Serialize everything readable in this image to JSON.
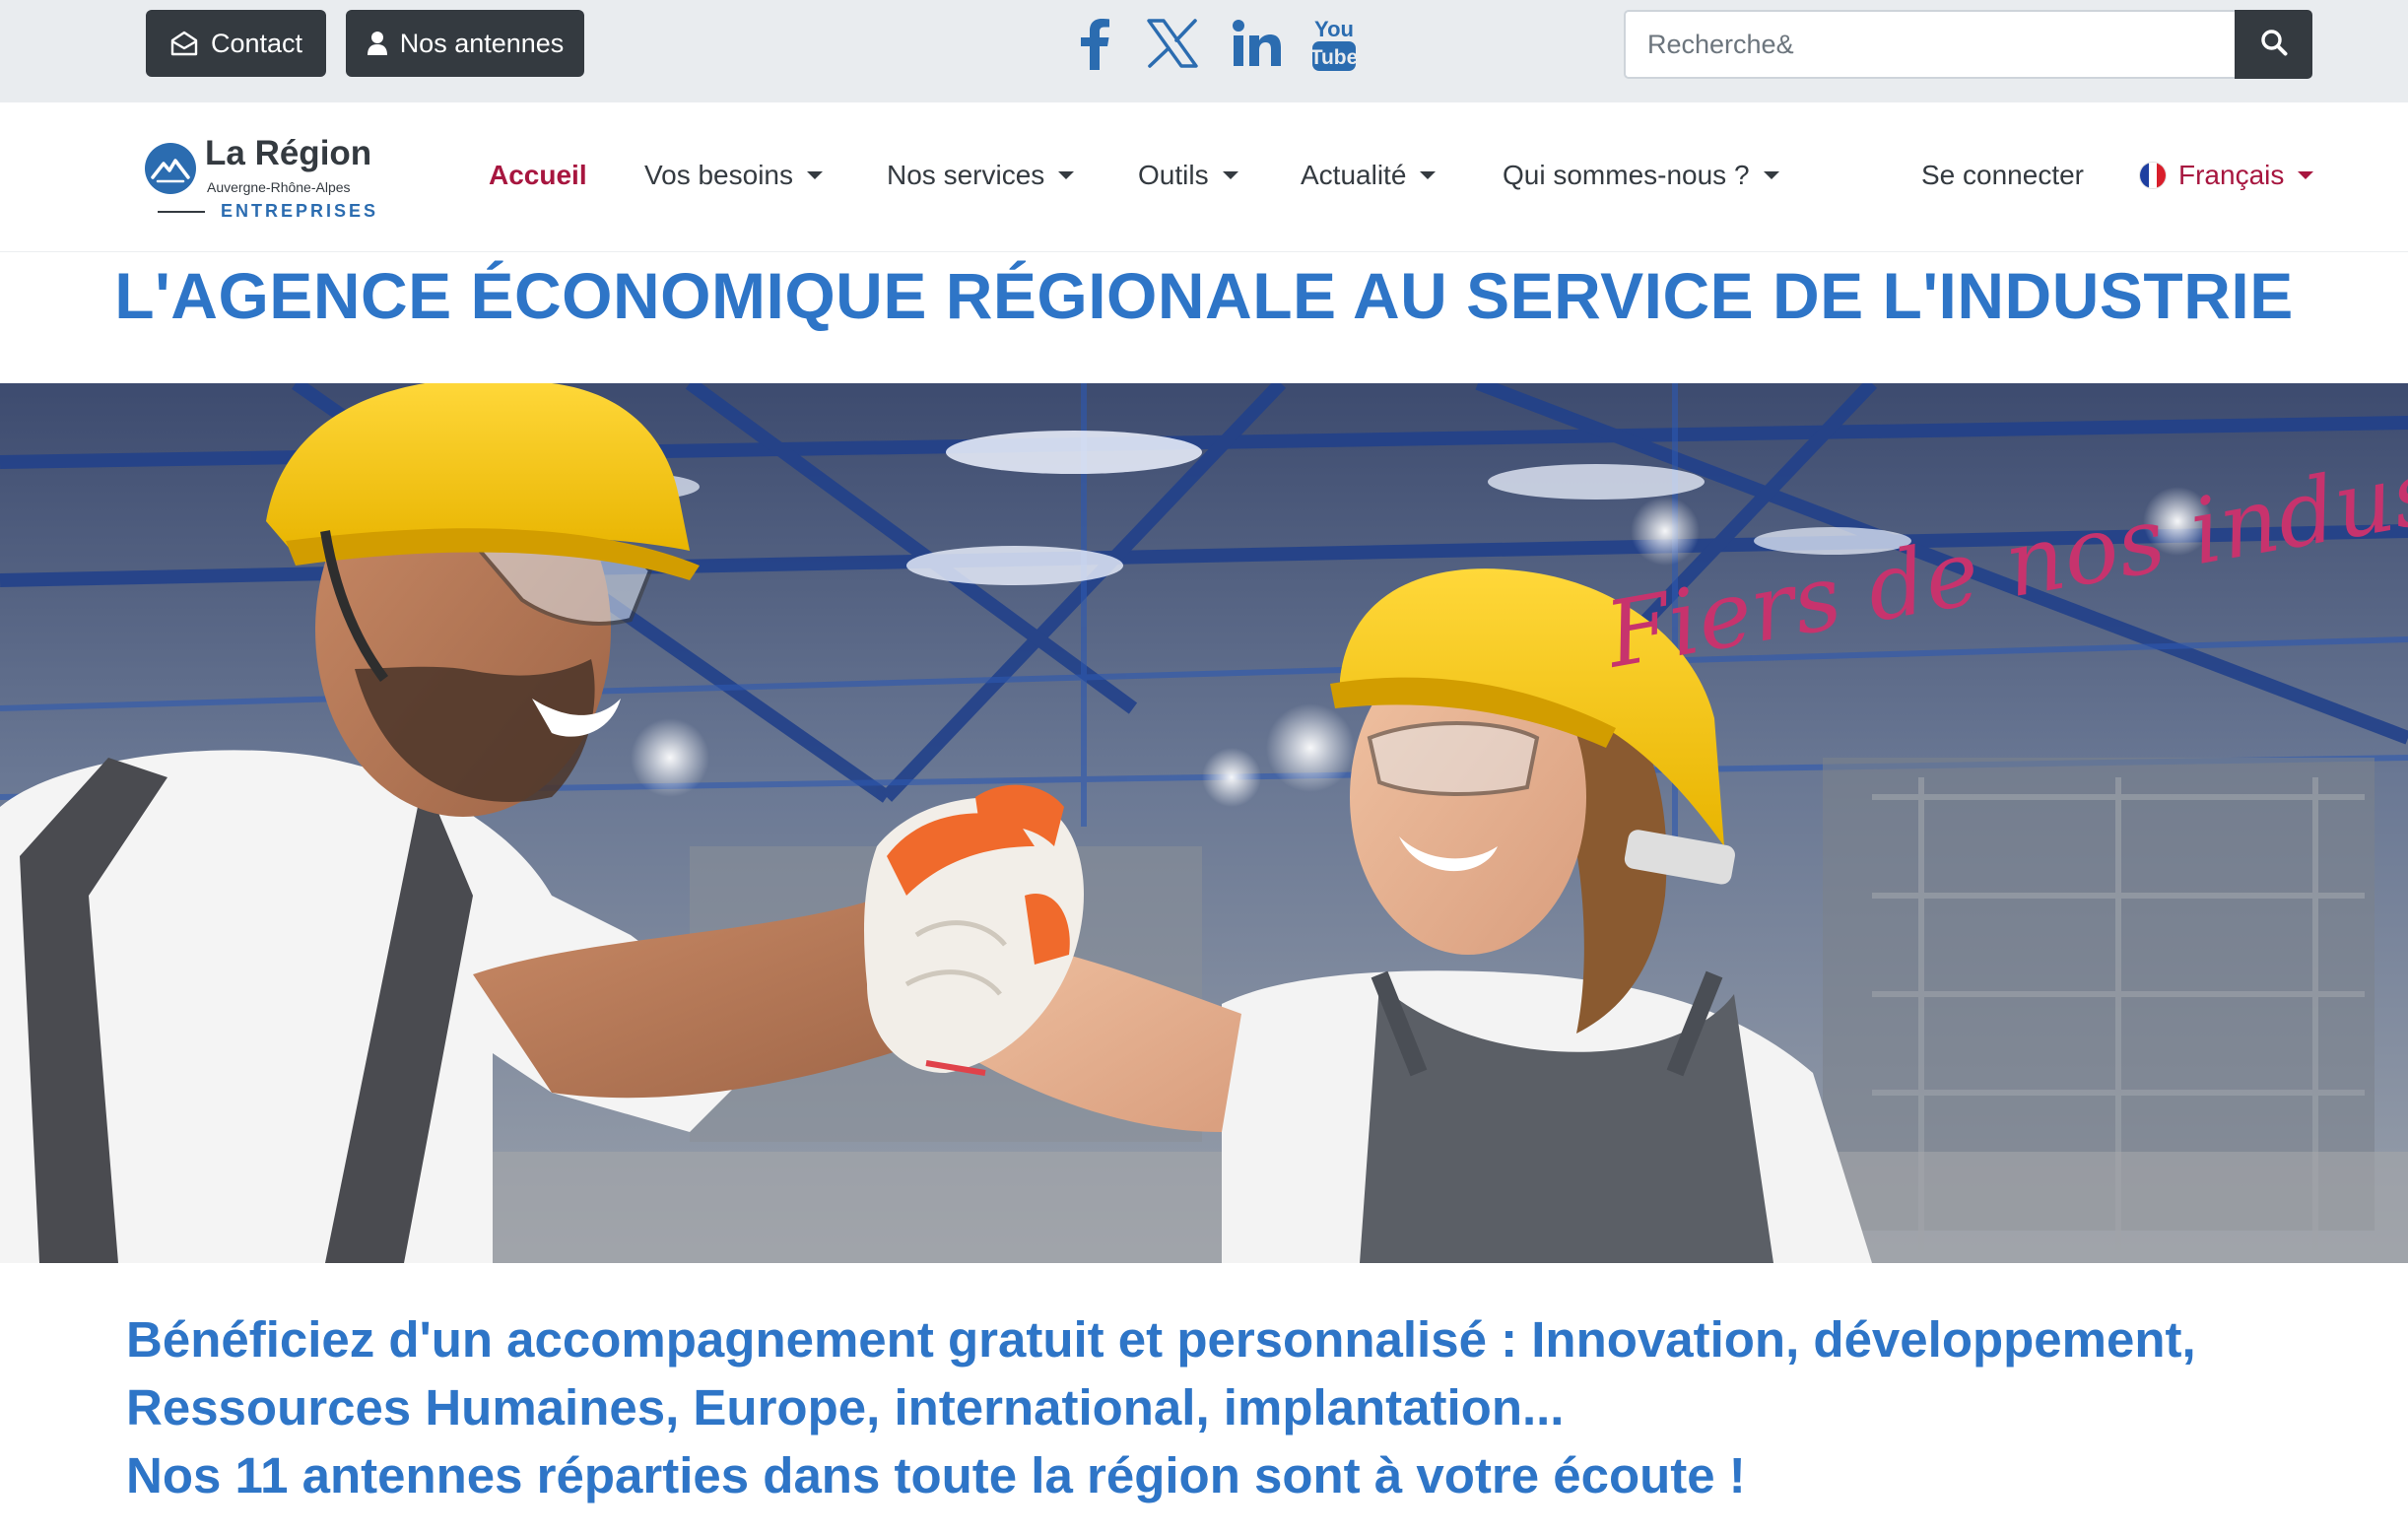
{
  "topbar": {
    "contact_label": "Contact",
    "antennes_label": "Nos antennes",
    "socials": [
      "facebook-icon",
      "x-icon",
      "linkedin-icon",
      "youtube-icon"
    ],
    "youtube_text_top": "You",
    "youtube_text_bottom": "Tube",
    "search": {
      "placeholder": "Recherche&"
    }
  },
  "logo": {
    "title": "La Région",
    "subtitle": "Auvergne-Rhône-Alpes",
    "tagline": "ENTREPRISES"
  },
  "nav": {
    "items": [
      {
        "label": "Accueil",
        "active": true,
        "dropdown": false
      },
      {
        "label": "Vos besoins",
        "active": false,
        "dropdown": true
      },
      {
        "label": "Nos services",
        "active": false,
        "dropdown": true
      },
      {
        "label": "Outils",
        "active": false,
        "dropdown": true
      },
      {
        "label": "Actualité",
        "active": false,
        "dropdown": true
      },
      {
        "label": "Qui sommes-nous ?",
        "active": false,
        "dropdown": true
      }
    ],
    "login_label": "Se connecter",
    "language_label": "Français"
  },
  "headline": "L'AGENCE ÉCONOMIQUE RÉGIONALE AU SERVICE DE L'INDUSTRIE",
  "hero": {
    "slogan": "Fiers de nos industries"
  },
  "intro": {
    "line1": "Bénéficiez d'un accompagnement gratuit et personnalisé : Innovation, développement,",
    "line2": "Ressources Humaines, Europe, international, implantation...",
    "line3": "Nos 11 antennes réparties dans toute la région sont à votre écoute !"
  },
  "colors": {
    "brand_blue": "#2e75c7",
    "accent_red": "#a7163f",
    "dark": "#343a40",
    "topbar_bg": "#e9ecef",
    "social_blue": "#2b6cb0"
  }
}
